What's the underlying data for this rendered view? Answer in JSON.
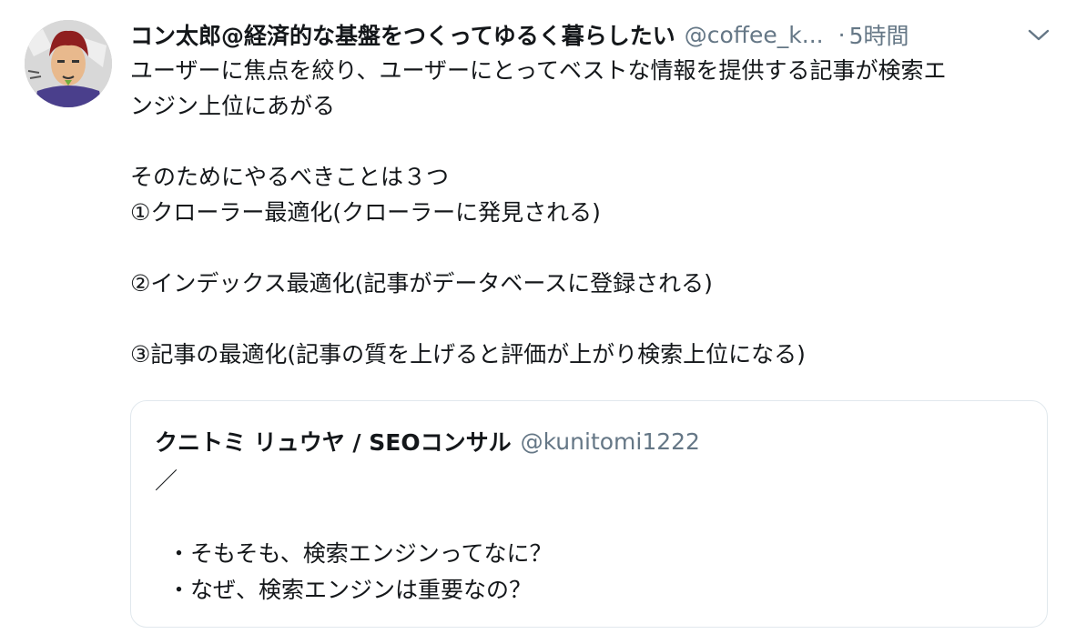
{
  "tweet": {
    "author_name": "コン太郎@経済的な基盤をつくってゆるく暮らしたい",
    "handle": "@coffee_k...",
    "separator": "·",
    "time": "5時間",
    "avatar_icon": "user-avatar-icon",
    "menu_icon": "chevron-down-icon",
    "body_lines": [
      "ユーザーに焦点を絞り、ユーザーにとってベストな情報を提供する記事が検索エ",
      "ンジン上位にあがる",
      "",
      "そのためにやるべきことは３つ",
      "①クローラー最適化(クローラーに発見される)",
      "",
      "②インデックス最適化(記事がデータベースに登録される)",
      "",
      "③記事の最適化(記事の質を上げると評価が上がり検索上位になる)"
    ]
  },
  "quoted_tweet": {
    "author_name": "クニトミ リュウヤ / SEOコンサル",
    "handle": "@kunitomi1222",
    "body_lines": [
      "／",
      "",
      "・そもそも、検索エンジンってなに？",
      "・なぜ、検索エンジンは重要なの？"
    ]
  },
  "colors": {
    "text": "#14171a",
    "secondary": "#657786",
    "border": "#e1e8ed"
  }
}
